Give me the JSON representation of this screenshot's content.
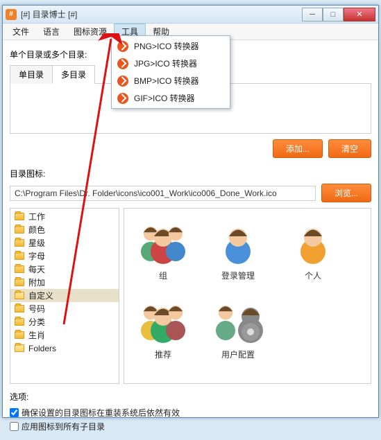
{
  "titlebar": {
    "icon_text": "#",
    "title": "[#] 目录博士 [#]"
  },
  "win_buttons": {
    "min": "─",
    "max": "□",
    "close": "✕"
  },
  "menubar": {
    "items": [
      "文件",
      "语言",
      "图标资源",
      "工具",
      "帮助"
    ],
    "active_index": 3
  },
  "dropdown": {
    "items": [
      "PNG>ICO 转换器",
      "JPG>ICO 转换器",
      "BMP>ICO 转换器",
      "GIF>ICO 转换器"
    ]
  },
  "section1_label": "单个目录或多个目录:",
  "tabs": {
    "items": [
      "单目录",
      "多目录"
    ],
    "active_index": 1
  },
  "buttons": {
    "add": "添加...",
    "clear": "清空",
    "browse": "浏览..."
  },
  "section2_label": "目录图标:",
  "path_value": "C:\\Program Files\\Dr. Folder\\icons\\ico001_Work\\ico006_Done_Work.ico",
  "tree": {
    "items": [
      "工作",
      "颜色",
      "星级",
      "字母",
      "每天",
      "附加",
      "自定义",
      "号码",
      "分类",
      "生肖",
      "Folders"
    ],
    "selected_index": 6
  },
  "grid": {
    "items": [
      "组",
      "登录管理",
      "个人",
      "推荐",
      "用户配置"
    ]
  },
  "options_label": "选项:",
  "checkbox1": {
    "label": "确保设置的目录图标在重装系统后依然有效",
    "checked": true
  },
  "checkbox2": {
    "label": "应用图标到所有子目录",
    "checked": false
  }
}
